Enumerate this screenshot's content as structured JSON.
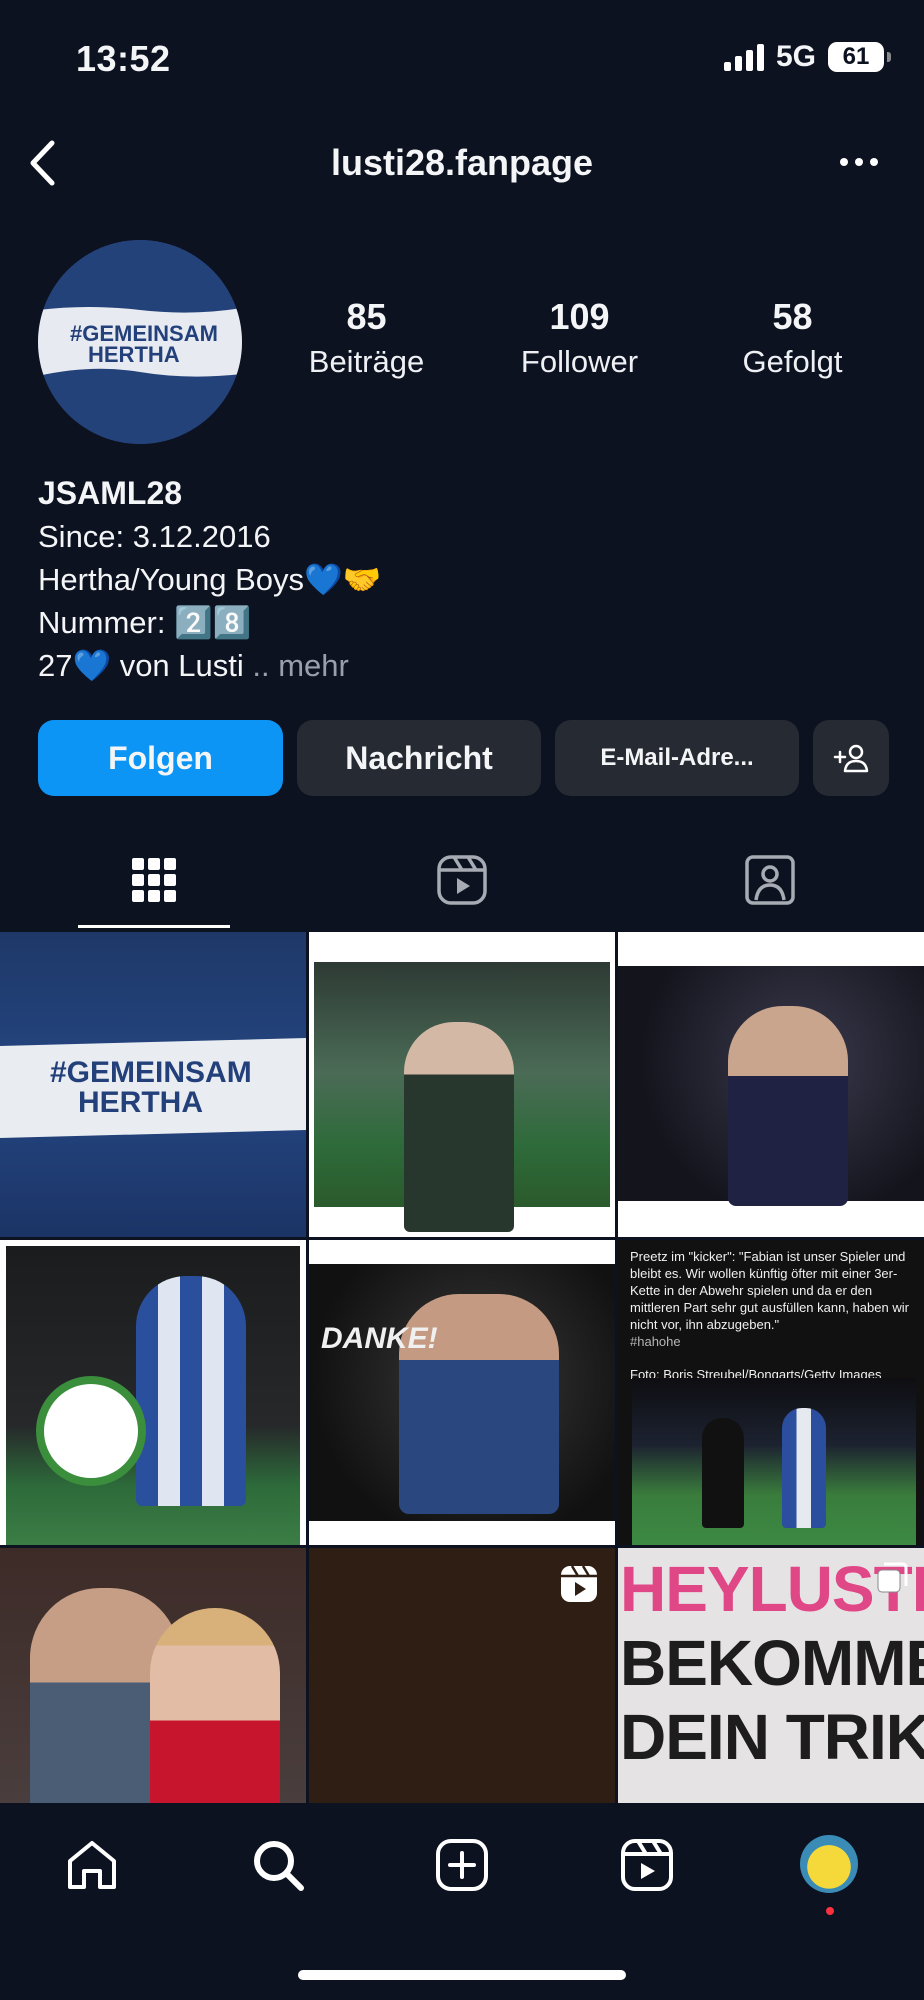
{
  "status_bar": {
    "time": "13:52",
    "network": "5G",
    "battery": "61"
  },
  "header": {
    "title": "lusti28.fanpage"
  },
  "profile": {
    "avatar_tag_line1": "#GEMEINSAM",
    "avatar_tag_line2": "HERTHA",
    "stats": [
      {
        "value": "85",
        "label": "Beiträge"
      },
      {
        "value": "109",
        "label": "Follower"
      },
      {
        "value": "58",
        "label": "Gefolgt"
      }
    ],
    "name": "JSAML28",
    "bio_lines": [
      "Since: 3.12.2016",
      "Hertha/Young Boys💙🤝",
      "Nummer: 2️⃣8️⃣"
    ],
    "bio_last": "27💙 von Lusti",
    "bio_ellipsis": " ..",
    "more_label": " mehr"
  },
  "actions": {
    "follow": "Folgen",
    "message": "Nachricht",
    "email": "E-Mail-Adre..."
  },
  "tabs": [
    "grid-icon",
    "reels-icon",
    "tagged-icon"
  ],
  "posts": {
    "p1": {
      "line1": "#GEMEINSAM",
      "line2": "HERTHA"
    },
    "p5": {
      "text": "DANKE!"
    },
    "p6": {
      "quote": "Preetz im \"kicker\": \"Fabian ist unser Spieler und bleibt es. Wir wollen künftig öfter mit einer 3er-Kette in der Abwehr spielen und da er den mittleren Part sehr gut ausfüllen kann, haben wir nicht vor, ihn abzugeben.\"",
      "hashtag": "#hahohe",
      "credit": "Foto: Boris Streubel/Bongarts/Getty Images"
    },
    "p9": {
      "line1": "HEYLUSTI",
      "line2": "BEKOMME ICH",
      "line3": "DEIN TRIKOT"
    }
  },
  "bottom_nav": [
    "home-icon",
    "search-icon",
    "create-icon",
    "reels-icon",
    "profile-avatar"
  ],
  "colors": {
    "follow_button": "#0d95f6",
    "background": "#0d1220",
    "button": "#262a33"
  }
}
